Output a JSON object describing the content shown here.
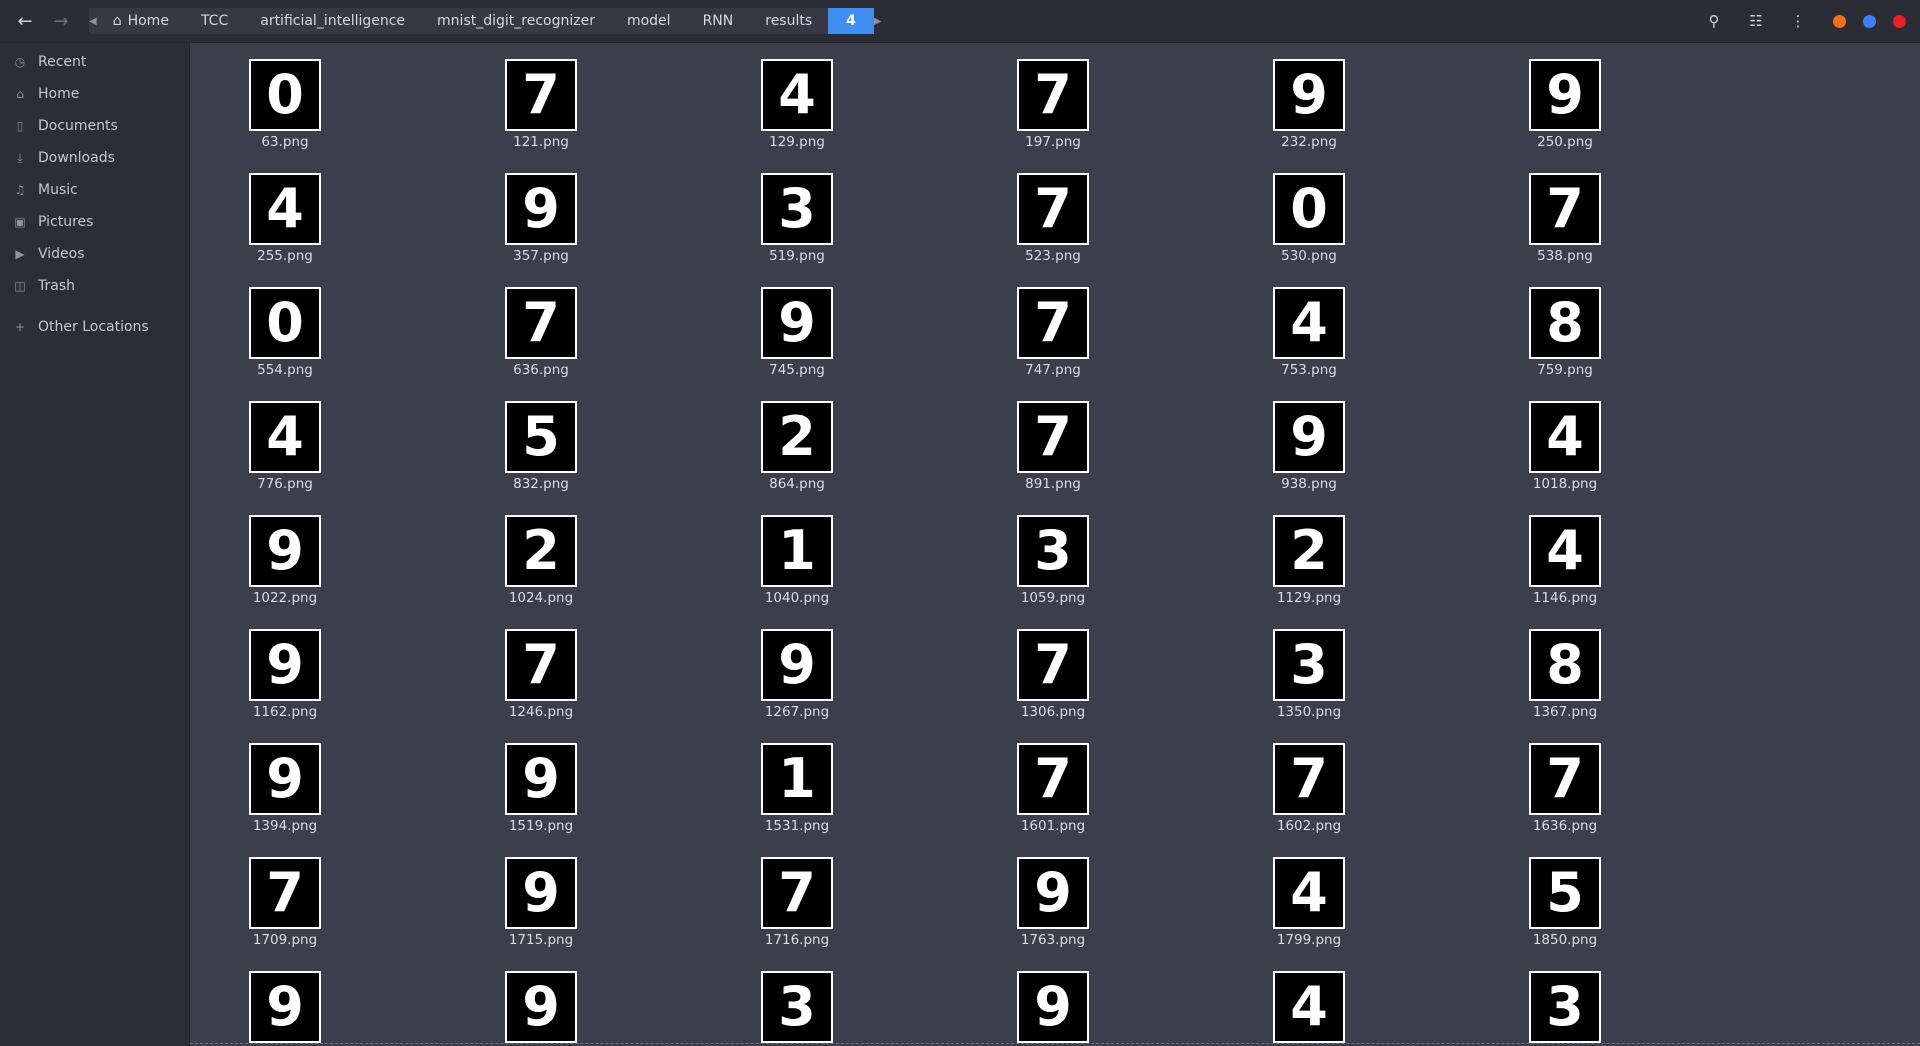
{
  "header": {
    "back_icon": "arrow-left-icon",
    "forward_icon": "arrow-right-icon",
    "breadcrumbs": [
      "Home",
      "TCC",
      "artificial_intelligence",
      "mnist_digit_recognizer",
      "model",
      "RNN",
      "results",
      "4"
    ],
    "search_icon": "search-icon",
    "view_icon": "view-toggle-icon",
    "menu_icon": "kebab-menu-icon",
    "window_colors": [
      "#f0711c",
      "#3f7ff0",
      "#e8202a"
    ]
  },
  "sidebar": {
    "items": [
      {
        "label": "Recent",
        "icon": "clock-icon"
      },
      {
        "label": "Home",
        "icon": "home-icon"
      },
      {
        "label": "Documents",
        "icon": "document-icon"
      },
      {
        "label": "Downloads",
        "icon": "download-icon"
      },
      {
        "label": "Music",
        "icon": "music-icon"
      },
      {
        "label": "Pictures",
        "icon": "picture-icon"
      },
      {
        "label": "Videos",
        "icon": "video-icon"
      },
      {
        "label": "Trash",
        "icon": "trash-icon"
      },
      {
        "label": "Other Locations",
        "icon": "plus-icon"
      }
    ]
  },
  "files": [
    {
      "name": "63.png",
      "digit": "0"
    },
    {
      "name": "121.png",
      "digit": "7"
    },
    {
      "name": "129.png",
      "digit": "4"
    },
    {
      "name": "197.png",
      "digit": "7"
    },
    {
      "name": "232.png",
      "digit": "9"
    },
    {
      "name": "250.png",
      "digit": "9"
    },
    {
      "name": "255.png",
      "digit": "4"
    },
    {
      "name": "357.png",
      "digit": "9"
    },
    {
      "name": "519.png",
      "digit": "3"
    },
    {
      "name": "523.png",
      "digit": "7"
    },
    {
      "name": "530.png",
      "digit": "0"
    },
    {
      "name": "538.png",
      "digit": "7"
    },
    {
      "name": "554.png",
      "digit": "0"
    },
    {
      "name": "636.png",
      "digit": "7"
    },
    {
      "name": "745.png",
      "digit": "9"
    },
    {
      "name": "747.png",
      "digit": "7"
    },
    {
      "name": "753.png",
      "digit": "4"
    },
    {
      "name": "759.png",
      "digit": "8"
    },
    {
      "name": "776.png",
      "digit": "4"
    },
    {
      "name": "832.png",
      "digit": "5"
    },
    {
      "name": "864.png",
      "digit": "2"
    },
    {
      "name": "891.png",
      "digit": "7"
    },
    {
      "name": "938.png",
      "digit": "9"
    },
    {
      "name": "1018.png",
      "digit": "4"
    },
    {
      "name": "1022.png",
      "digit": "9"
    },
    {
      "name": "1024.png",
      "digit": "2"
    },
    {
      "name": "1040.png",
      "digit": "1"
    },
    {
      "name": "1059.png",
      "digit": "3"
    },
    {
      "name": "1129.png",
      "digit": "2"
    },
    {
      "name": "1146.png",
      "digit": "4"
    },
    {
      "name": "1162.png",
      "digit": "9"
    },
    {
      "name": "1246.png",
      "digit": "7"
    },
    {
      "name": "1267.png",
      "digit": "9"
    },
    {
      "name": "1306.png",
      "digit": "7"
    },
    {
      "name": "1350.png",
      "digit": "3"
    },
    {
      "name": "1367.png",
      "digit": "8"
    },
    {
      "name": "1394.png",
      "digit": "9"
    },
    {
      "name": "1519.png",
      "digit": "9"
    },
    {
      "name": "1531.png",
      "digit": "1"
    },
    {
      "name": "1601.png",
      "digit": "7"
    },
    {
      "name": "1602.png",
      "digit": "7"
    },
    {
      "name": "1636.png",
      "digit": "7"
    },
    {
      "name": "1709.png",
      "digit": "7"
    },
    {
      "name": "1715.png",
      "digit": "9"
    },
    {
      "name": "1716.png",
      "digit": "7"
    },
    {
      "name": "1763.png",
      "digit": "9"
    },
    {
      "name": "1799.png",
      "digit": "4"
    },
    {
      "name": "1850.png",
      "digit": "5"
    },
    {
      "name": "",
      "digit": "9"
    },
    {
      "name": "",
      "digit": "9"
    },
    {
      "name": "",
      "digit": "3"
    },
    {
      "name": "",
      "digit": "9"
    },
    {
      "name": "",
      "digit": "4"
    },
    {
      "name": "",
      "digit": "3"
    }
  ]
}
